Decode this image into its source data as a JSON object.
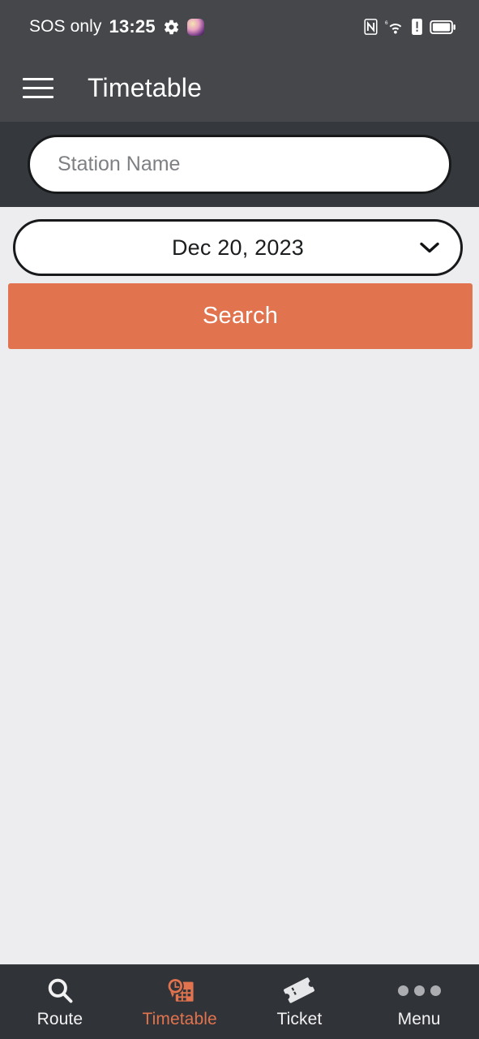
{
  "status_bar": {
    "carrier": "SOS only",
    "time": "13:25",
    "icons": [
      "gear-icon",
      "app-icon",
      "nfc-icon",
      "wifi-6-icon",
      "alert-icon",
      "battery-icon"
    ]
  },
  "app_bar": {
    "menu_icon": "hamburger-icon",
    "title": "Timetable"
  },
  "search": {
    "station_placeholder": "Station Name",
    "station_value": ""
  },
  "date_picker": {
    "value": "Dec 20, 2023",
    "chevron": "chevron-down-icon"
  },
  "actions": {
    "search_label": "Search"
  },
  "bottom_nav": {
    "items": [
      {
        "label": "Route",
        "icon": "search-icon",
        "active": false
      },
      {
        "label": "Timetable",
        "icon": "timetable-icon",
        "active": true
      },
      {
        "label": "Ticket",
        "icon": "ticket-icon",
        "active": false
      },
      {
        "label": "Menu",
        "icon": "more-dots-icon",
        "active": false
      }
    ]
  },
  "colors": {
    "accent": "#E1734E",
    "app_bar": "#45474B",
    "search_band": "#35383C",
    "content_bg": "#EDEDEF",
    "nav_bg": "#303338"
  }
}
